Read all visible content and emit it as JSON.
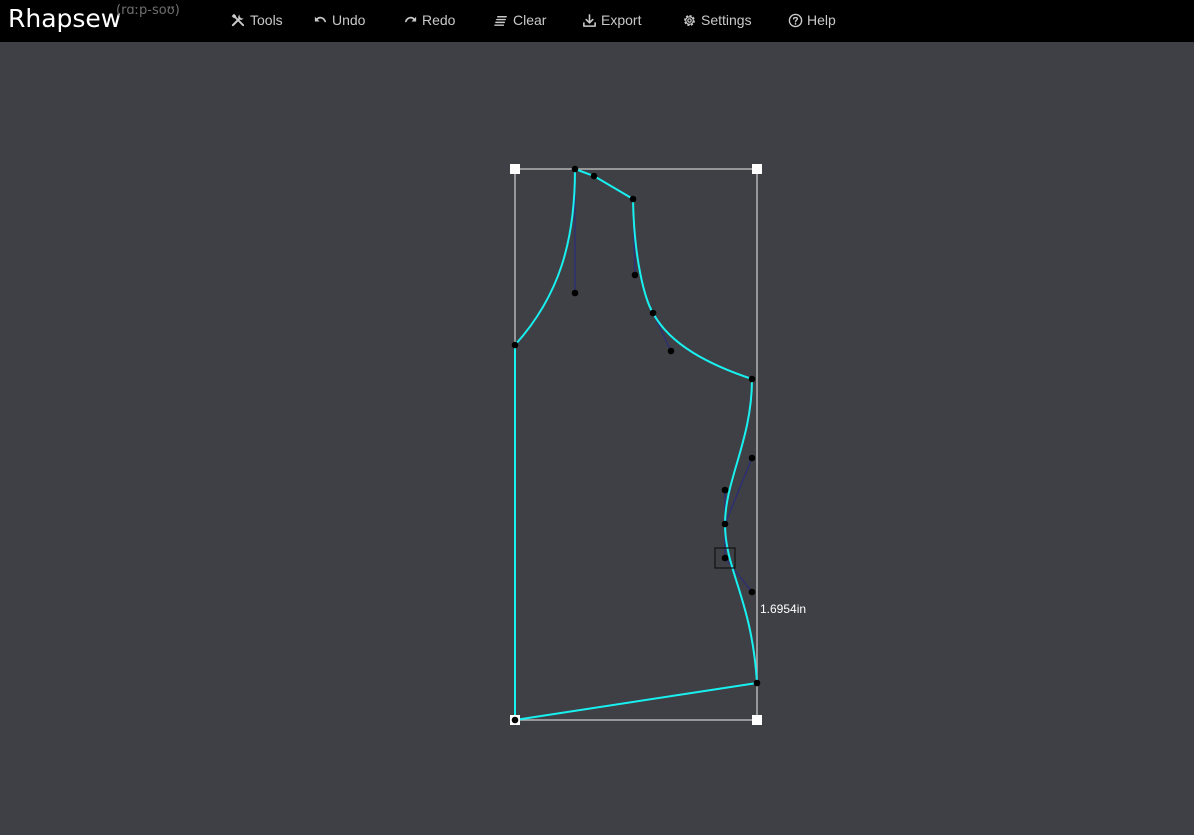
{
  "app": {
    "brand": "Rhapsew",
    "phonetic": "(rɑːp-soʊ)"
  },
  "menu": {
    "tools": {
      "label": "Tools",
      "icon": "tools-icon"
    },
    "undo": {
      "label": "Undo",
      "icon": "undo-icon"
    },
    "redo": {
      "label": "Redo",
      "icon": "redo-icon"
    },
    "clear": {
      "label": "Clear",
      "icon": "clear-icon"
    },
    "export": {
      "label": "Export",
      "icon": "download-icon"
    },
    "settings": {
      "label": "Settings",
      "icon": "gear-icon"
    },
    "help": {
      "label": "Help",
      "icon": "question-circle-icon"
    }
  },
  "canvas": {
    "measurement_label": "1.6954in",
    "colors": {
      "background": "#3e4045",
      "pattern_line": "#19f0f0",
      "handle_line": "#2c2c78",
      "bounding_box": "#b4b4b4",
      "point": "#000000"
    }
  }
}
